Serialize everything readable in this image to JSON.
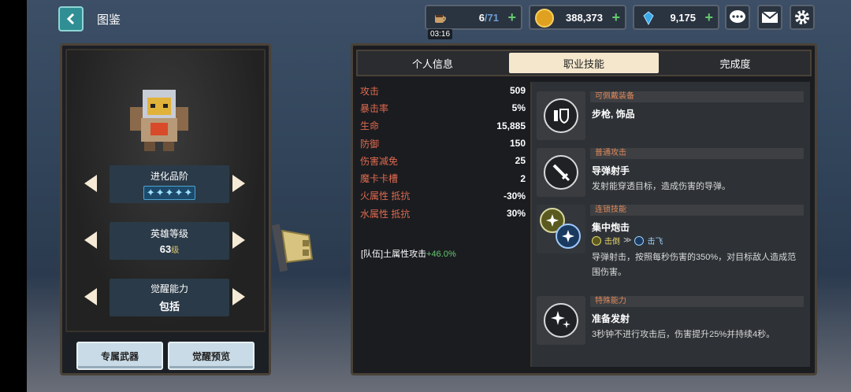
{
  "header": {
    "title": "图鉴",
    "stamina": {
      "current": "6",
      "max": "/71",
      "timer": "03:16"
    },
    "gold": "388,373",
    "gems": "9,175"
  },
  "left_panel": {
    "evolution": {
      "label": "进化品阶",
      "stars": 5
    },
    "level": {
      "label": "英雄等级",
      "value": "63",
      "unit": "级"
    },
    "awakening": {
      "label": "觉醒能力",
      "value": "包括"
    },
    "buttons": {
      "exclusive_weapon": "专属武器",
      "awaken_preview": "觉醒预览"
    }
  },
  "tabs": [
    {
      "label": "个人信息",
      "active": false
    },
    {
      "label": "职业技能",
      "active": true
    },
    {
      "label": "完成度",
      "active": false
    }
  ],
  "stats": [
    {
      "key": "攻击",
      "value": "509"
    },
    {
      "key": "暴击率",
      "value": "5%"
    },
    {
      "key": "生命",
      "value": "15,885"
    },
    {
      "key": "防御",
      "value": "150"
    },
    {
      "key": "伤害减免",
      "value": "25"
    },
    {
      "key": "魔卡卡槽",
      "value": "2"
    },
    {
      "key": "火属性 抵抗",
      "value": "-30%"
    },
    {
      "key": "水属性 抵抗",
      "value": "30%"
    }
  ],
  "team_bonus": {
    "text": "[队伍]土属性攻击",
    "value": "+46.0%"
  },
  "skills": {
    "equip": {
      "category": "可佩戴装备",
      "name": "步枪, 饰品"
    },
    "normal": {
      "category": "普通攻击",
      "name": "导弹射手",
      "desc": "发射能穿透目标，造成伤害的导弹。"
    },
    "chain": {
      "category": "连锁技能",
      "name": "集中炮击",
      "tag1": "击倒",
      "sep": "≫",
      "tag2": "击飞",
      "desc": "导弹射击，按照每秒伤害的350%，对目标敌人造成范围伤害。"
    },
    "special": {
      "category": "特殊能力",
      "name": "准备发射",
      "desc": "3秒钟不进行攻击后，伤害提升25%并持续4秒。"
    }
  },
  "colors": {
    "accent_teal": "#2f8f94",
    "stat_key": "#e06a4e",
    "bonus_green": "#67c870",
    "tab_active": "#f4e7cc"
  }
}
